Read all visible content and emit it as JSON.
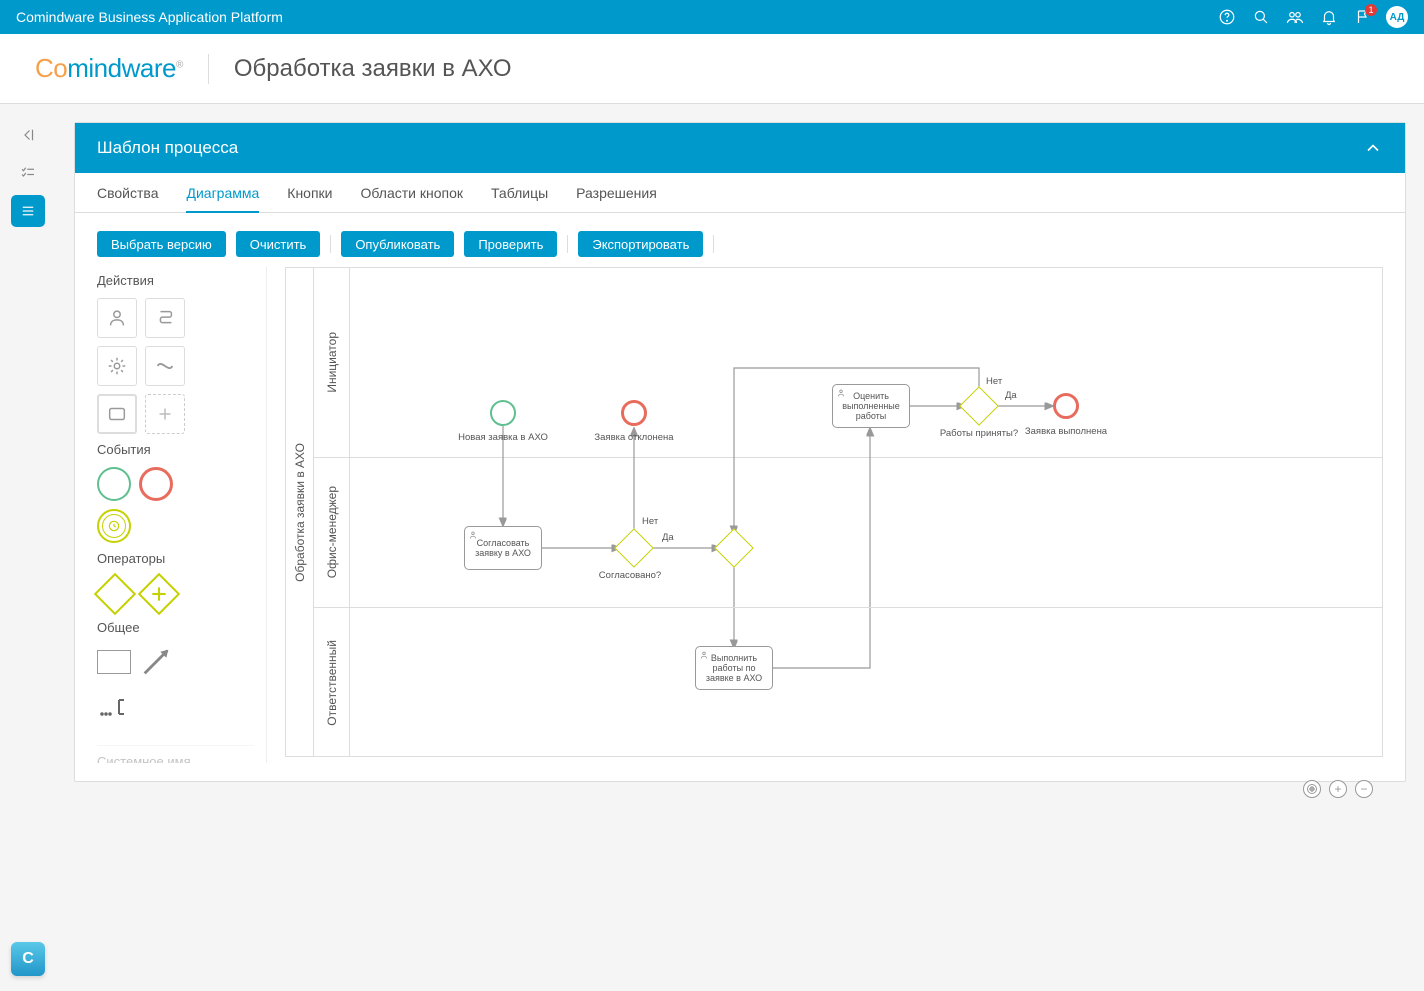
{
  "topbar": {
    "title": "Comindware Business Application Platform",
    "badge_count": "1",
    "avatar_initials": "АД"
  },
  "header": {
    "logo_part1": "Co",
    "logo_part2": "mindware",
    "page_title": "Обработка заявки в АХО"
  },
  "panel": {
    "title": "Шаблон процесса"
  },
  "tabs": [
    {
      "label": "Свойства",
      "active": false
    },
    {
      "label": "Диаграмма",
      "active": true
    },
    {
      "label": "Кнопки",
      "active": false
    },
    {
      "label": "Области кнопок",
      "active": false
    },
    {
      "label": "Таблицы",
      "active": false
    },
    {
      "label": "Разрешения",
      "active": false
    }
  ],
  "toolbar": {
    "select_version": "Выбрать версию",
    "clear": "Очистить",
    "publish": "Опубликовать",
    "validate": "Проверить",
    "export": "Экспортировать"
  },
  "palette": {
    "actions_title": "Действия",
    "events_title": "События",
    "operators_title": "Операторы",
    "general_title": "Общее",
    "truncated_label": "Системное имя"
  },
  "diagram": {
    "pool_label": "Обработка заявки в АХО",
    "lanes": [
      {
        "label": "Инициатор"
      },
      {
        "label": "Офис-менеджер"
      },
      {
        "label": "Ответственный"
      }
    ],
    "start_event": "Новая заявка в АХО",
    "reject_event": "Заявка отклонена",
    "done_event": "Заявка выполнена",
    "task_approve": "Согласовать заявку в АХО",
    "task_evaluate": "Оценить выполненные работы",
    "task_execute": "Выполнить работы по заявке в АХО",
    "gw_approved": "Согласовано?",
    "gw_accepted": "Работы приняты?",
    "flow_yes": "Да",
    "flow_no": "Нет"
  }
}
